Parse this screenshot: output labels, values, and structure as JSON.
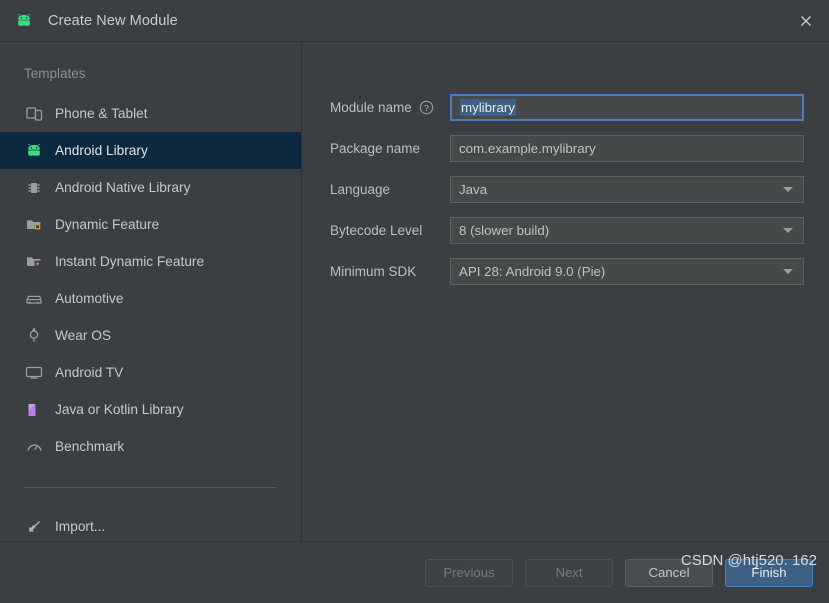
{
  "window": {
    "title": "Create New Module",
    "icon": "android-robot-icon",
    "close_label": "✕"
  },
  "sidebar": {
    "section_label": "Templates",
    "items": [
      {
        "label": "Phone & Tablet",
        "icon": "phone-tablet-icon",
        "selected": false
      },
      {
        "label": "Android Library",
        "icon": "android-robot-icon",
        "selected": true
      },
      {
        "label": "Android Native Library",
        "icon": "chip-icon",
        "selected": false
      },
      {
        "label": "Dynamic Feature",
        "icon": "folder-square-badge-icon",
        "selected": false
      },
      {
        "label": "Instant Dynamic Feature",
        "icon": "folder-bolt-badge-icon",
        "selected": false
      },
      {
        "label": "Automotive",
        "icon": "car-icon",
        "selected": false
      },
      {
        "label": "Wear OS",
        "icon": "watch-icon",
        "selected": false
      },
      {
        "label": "Android TV",
        "icon": "tv-monitor-icon",
        "selected": false
      },
      {
        "label": "Java or Kotlin Library",
        "icon": "kotlin-k-icon",
        "selected": false
      },
      {
        "label": "Benchmark",
        "icon": "speedometer-icon",
        "selected": false
      }
    ],
    "import_item": {
      "label": "Import...",
      "icon": "import-arrow-icon"
    }
  },
  "form": {
    "module_name": {
      "label": "Module name",
      "help_icon": "question-mark-icon",
      "value": "mylibrary",
      "focused": true,
      "selected": true
    },
    "package_name": {
      "label": "Package name",
      "value": "com.example.mylibrary"
    },
    "language": {
      "label": "Language",
      "value": "Java",
      "arrow_icon": "chevron-down-icon"
    },
    "bytecode_level": {
      "label": "Bytecode Level",
      "value": "8 (slower build)",
      "arrow_icon": "chevron-down-icon"
    },
    "minimum_sdk": {
      "label": "Minimum SDK",
      "value": "API 28: Android 9.0 (Pie)",
      "arrow_icon": "chevron-down-icon"
    }
  },
  "footer": {
    "previous": "Previous",
    "next": "Next",
    "cancel": "Cancel",
    "finish": "Finish"
  },
  "watermark": "CSDN @htj520. 162",
  "colors": {
    "window_bg": "#3c3f41",
    "selection_row": "#0d293f",
    "accent_blue": "#4a7ebb",
    "primary_button": "#3d6185",
    "android_green": "#3ddc84",
    "kotlin_purple": "#b77fe6",
    "folder_badge_orange": "#e8a33d"
  }
}
